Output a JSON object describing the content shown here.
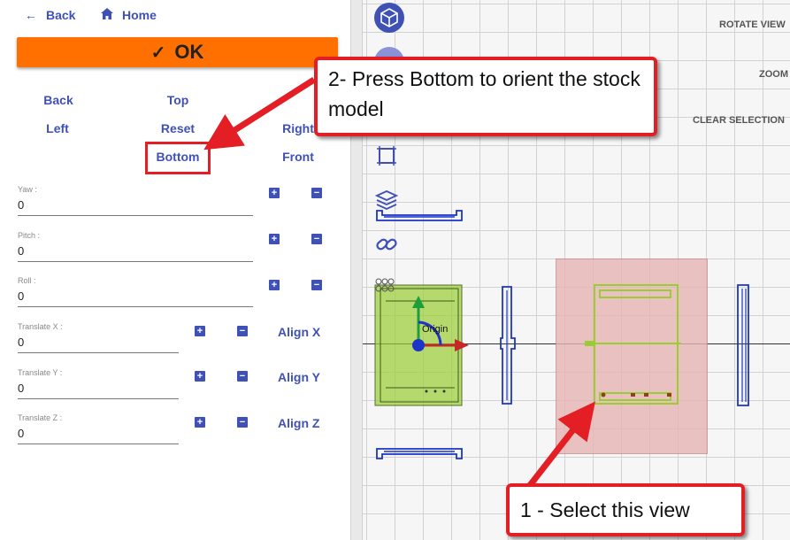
{
  "nav": {
    "back_label": "Back",
    "home_label": "Home"
  },
  "ok_label": "OK",
  "views": {
    "back": "Back",
    "top": "Top",
    "left": "Left",
    "reset": "Reset",
    "right": "Right",
    "bottom": "Bottom",
    "front": "Front"
  },
  "fields": {
    "yaw": {
      "label": "Yaw :",
      "value": "0"
    },
    "pitch": {
      "label": "Pitch :",
      "value": "0"
    },
    "roll": {
      "label": "Roll :",
      "value": "0"
    },
    "translate_x": {
      "label": "Translate X :",
      "value": "0"
    },
    "translate_y": {
      "label": "Translate Y :",
      "value": "0"
    },
    "translate_z": {
      "label": "Translate Z :",
      "value": "0"
    }
  },
  "buttons": {
    "plus": "+",
    "minus": "−",
    "align_x": "Align X",
    "align_y": "Align Y",
    "align_z": "Align Z"
  },
  "viewport": {
    "rotate_view": "ROTATE VIEW",
    "zoom": "ZOOM",
    "clear_selection": "CLEAR SELECTION",
    "origin_label": "Origin"
  },
  "callouts": {
    "press_bottom": "2- Press Bottom to orient the stock model",
    "select_view": "1 - Select this view"
  },
  "colors": {
    "accent": "#3f51b5",
    "ok_button": "#ff7000",
    "annotation_red": "#e31e25",
    "model_green": "#9acd32",
    "selection_pink": "#e8b4b4"
  }
}
